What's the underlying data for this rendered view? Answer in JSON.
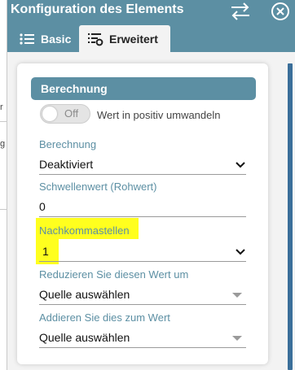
{
  "colors": {
    "titlebar": "#5c8fa3",
    "accent_label": "#5c8fa3",
    "highlight": "#ffff1e",
    "scrollbar": "#3b6f9a"
  },
  "window": {
    "title": "Konfiguration des Elements"
  },
  "icons": {
    "swap": "swap-arrows-icon",
    "close": "close-circle-icon",
    "basic_tab": "list-icon",
    "advanced_tab": "list-settings-icon"
  },
  "tabs": {
    "basic": "Basic",
    "advanced": "Erweitert"
  },
  "section": {
    "title": "Berechnung",
    "toggle": {
      "state": "Off",
      "label": "Wert in positiv umwandeln"
    },
    "fields": [
      {
        "label": "Berechnung",
        "value": "Deaktiviert"
      },
      {
        "label": "Schwellenwert (Rohwert)",
        "value": "0"
      },
      {
        "label": "Nachkommastellen",
        "value": "1"
      },
      {
        "label": "Reduzieren Sie diesen Wert um",
        "value": "Quelle auswählen"
      },
      {
        "label": "Addieren Sie dies zum Wert",
        "value": "Quelle auswählen"
      }
    ]
  },
  "background": {
    "glyphs": [
      "r",
      "g"
    ]
  }
}
